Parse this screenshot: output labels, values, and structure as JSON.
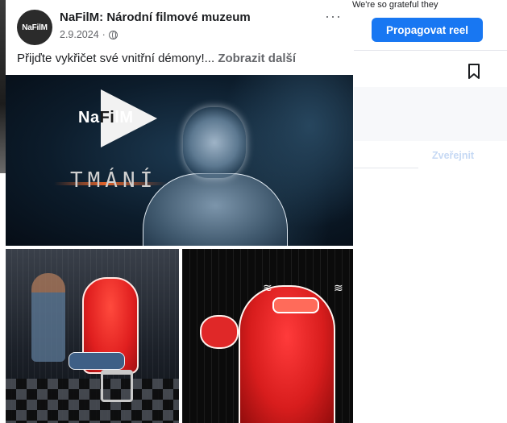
{
  "post": {
    "page_name": "NaFilM: Národní filmové muzeum",
    "avatar_text": "NaFilM",
    "date": "2.9.2024",
    "separator": "·",
    "more_label": "···",
    "caption": "Přijďte vykřičet své vnitřní démony!...",
    "see_more": "Zobrazit další"
  },
  "images": {
    "logo_text_left": "Na",
    "logo_text_mid": "Fi",
    "logo_text_right": "lM",
    "title": "TMÁNÍ"
  },
  "side": {
    "top_text": "We're so grateful they",
    "promote_label": "Propagovat reel",
    "publish_label": "Zveřejnit"
  },
  "colors": {
    "accent": "#1877f2",
    "text": "#1c1e21",
    "secondary": "#65676b"
  }
}
